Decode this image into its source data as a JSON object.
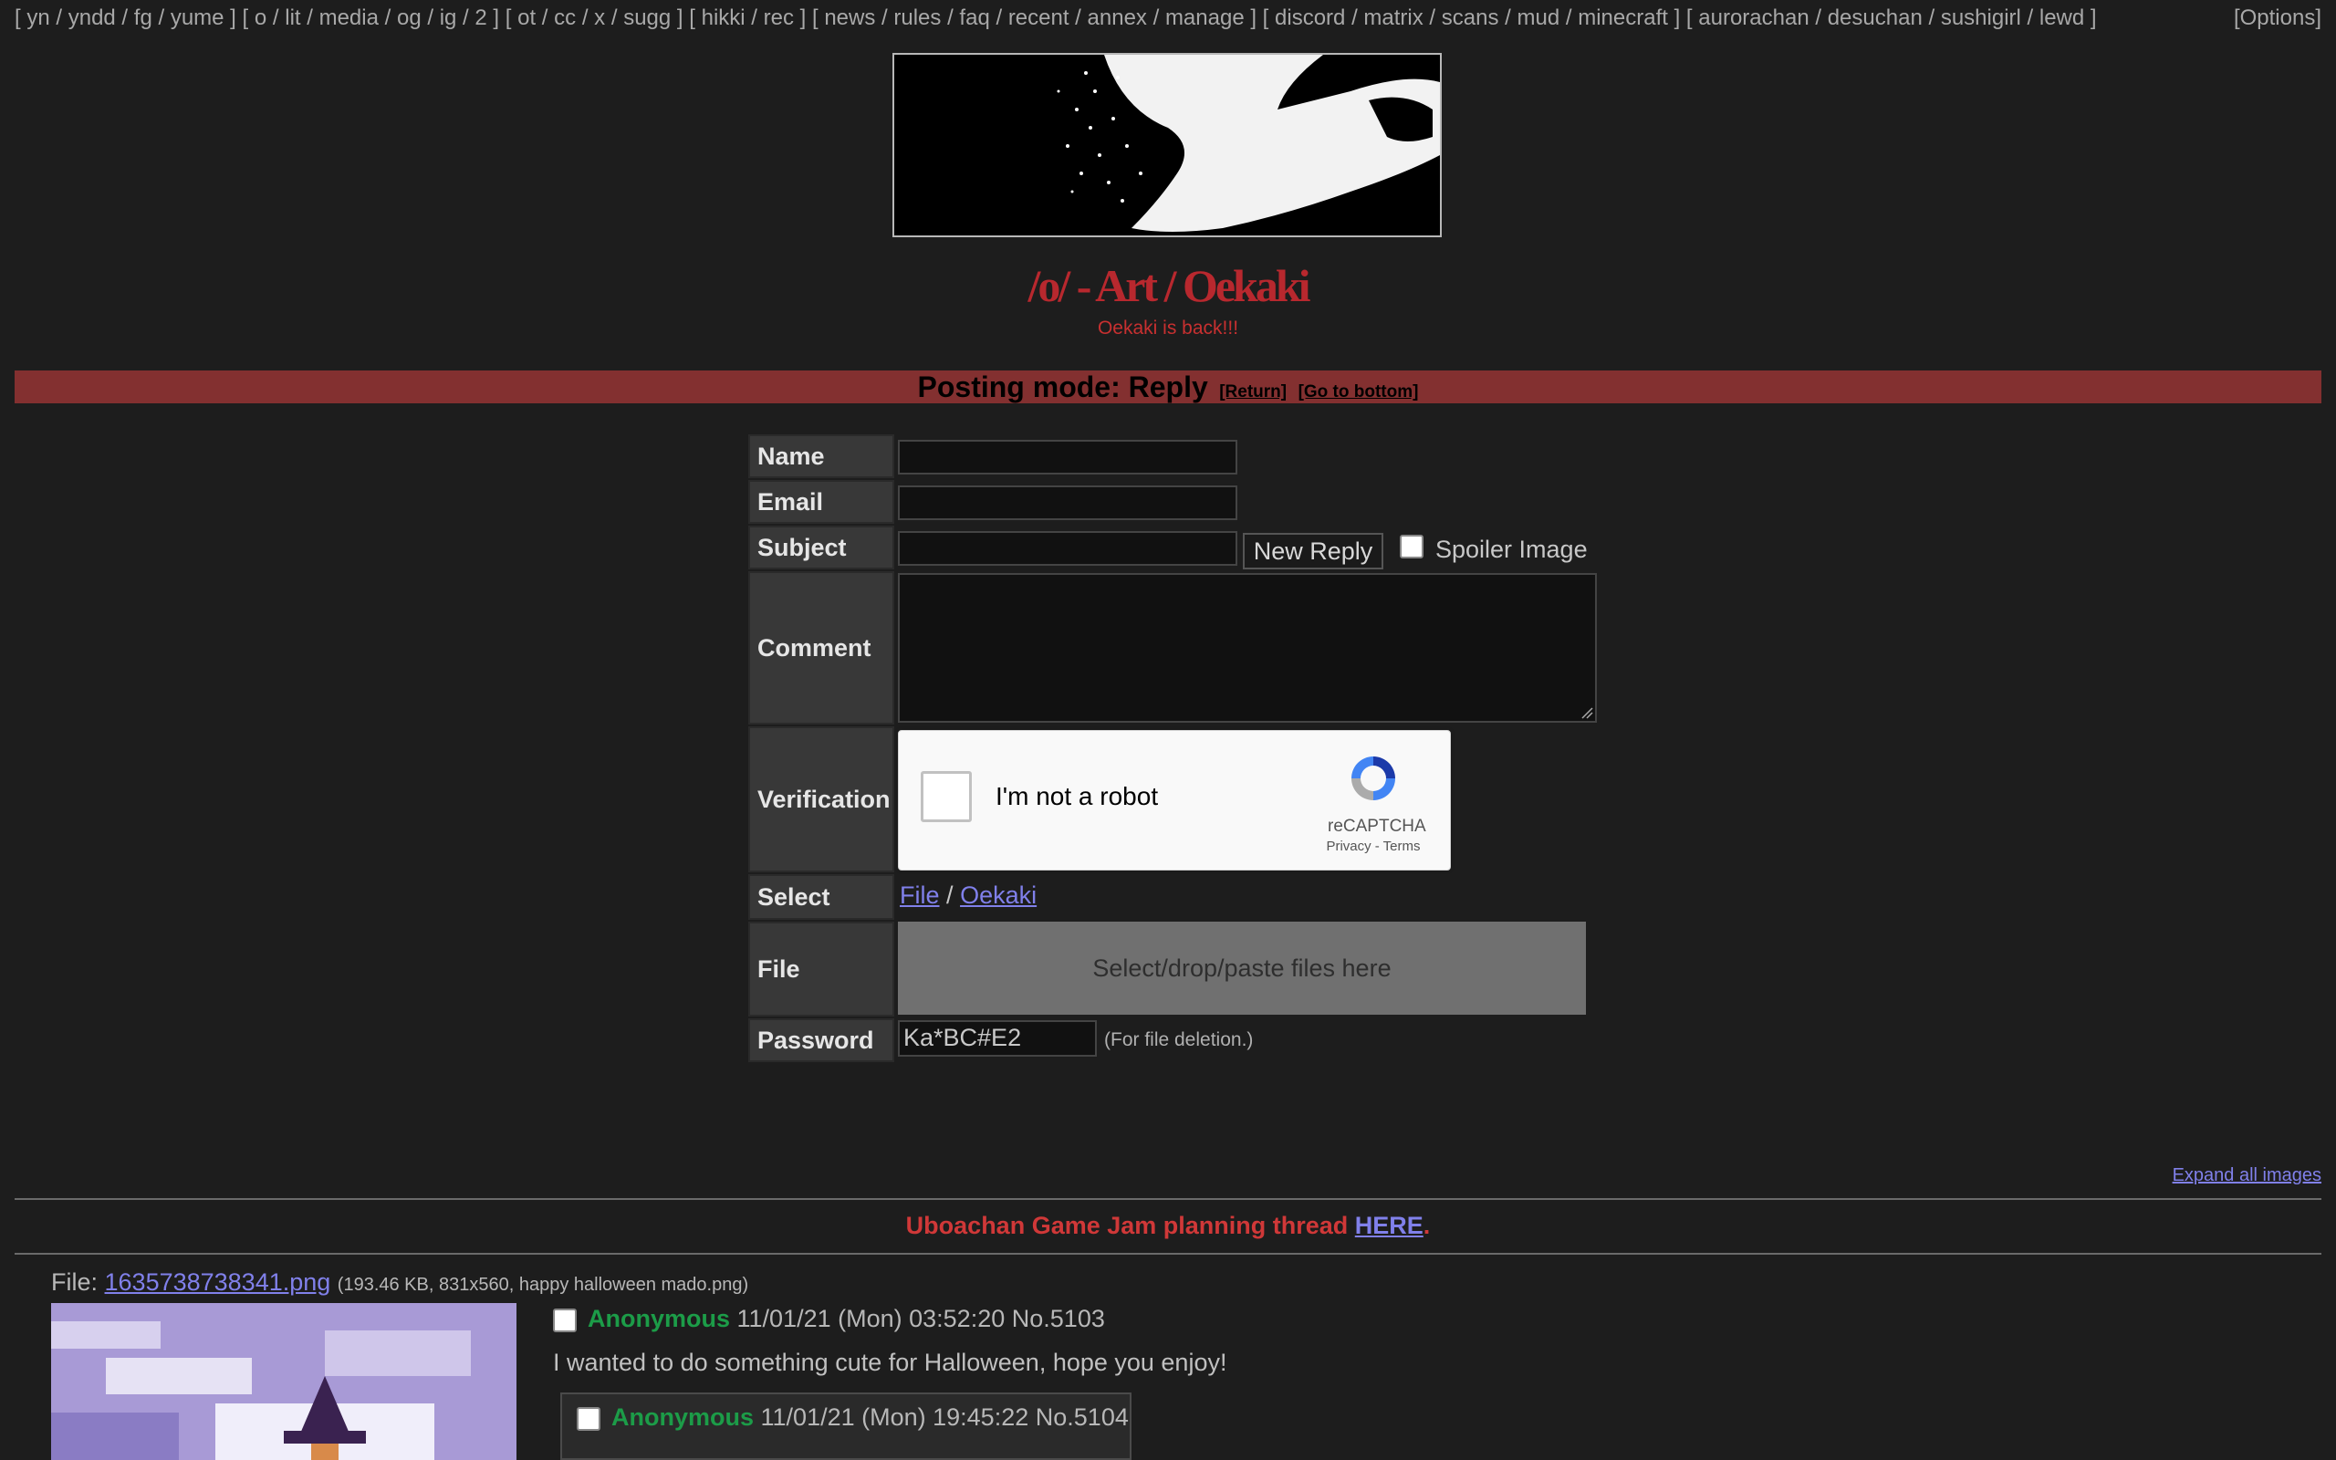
{
  "nav": {
    "groups": [
      [
        "yn",
        "yndd",
        "fg",
        "yume"
      ],
      [
        "o",
        "lit",
        "media",
        "og",
        "ig",
        "2"
      ],
      [
        "ot",
        "cc",
        "x",
        "sugg"
      ],
      [
        "hikki",
        "rec"
      ],
      [
        "news",
        "rules",
        "faq",
        "recent",
        "annex",
        "manage"
      ],
      [
        "discord",
        "matrix",
        "scans",
        "mud",
        "minecraft"
      ],
      [
        "aurorachan",
        "desuchan",
        "sushigirl",
        "lewd"
      ]
    ],
    "options_label": "[Options]"
  },
  "board": {
    "title": "/o/ - Art / Oekaki",
    "subtitle": "Oekaki is back!!!"
  },
  "mode_bar": {
    "mode_text": "Posting mode: Reply",
    "return_label": "[Return]",
    "bottom_label": "[Go to bottom]"
  },
  "form": {
    "name_label": "Name",
    "email_label": "Email",
    "subject_label": "Subject",
    "submit_label": "New Reply",
    "spoiler_label": "Spoiler Image",
    "comment_label": "Comment",
    "verification_label": "Verification",
    "captcha_text": "I'm not a robot",
    "captcha_brand": "reCAPTCHA",
    "captcha_links": "Privacy - Terms",
    "select_label": "Select",
    "select_file": "File",
    "select_sep": "/",
    "select_oekaki": "Oekaki",
    "file_label": "File",
    "dropzone_text": "Select/drop/paste files here",
    "password_label": "Password",
    "password_value": "Ka*BC#E2",
    "password_note": "(For file deletion.)"
  },
  "expand_all": "Expand all images",
  "announcement": {
    "text": "Uboachan Game Jam planning thread ",
    "link": "HERE",
    "tail": "."
  },
  "op": {
    "file_prefix": "File: ",
    "file_name": "1635738738341.png",
    "file_info": "(193.46 KB, 831x560, happy halloween mado.png)",
    "name": "Anonymous",
    "date": "11/01/21 (Mon) 03:52:20",
    "number": "No.5103",
    "body": "I wanted to do something cute for Halloween, hope you enjoy!"
  },
  "reply": {
    "name": "Anonymous",
    "date": "11/01/21 (Mon) 19:45:22",
    "number": "No.5104"
  },
  "colors": {
    "background": "#1d1d1d",
    "title_red": "#b8282e",
    "mode_bar": "#833030",
    "link": "#8080ea",
    "name_green": "#1c9c48"
  }
}
